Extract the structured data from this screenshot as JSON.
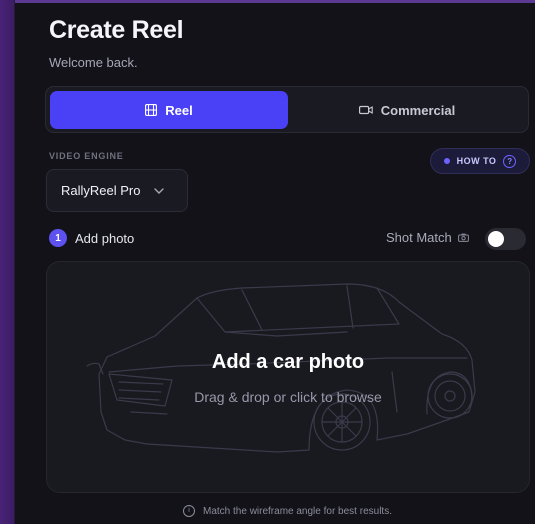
{
  "header": {
    "title": "Create Reel",
    "subtitle": "Welcome back."
  },
  "tabs": [
    {
      "label": "Reel",
      "icon": "film-icon",
      "active": true
    },
    {
      "label": "Commercial",
      "icon": "video-camera-icon",
      "active": false
    }
  ],
  "engine": {
    "label": "VIDEO ENGINE",
    "selected": "RallyReel Pro"
  },
  "how_to": {
    "label": "HOW TO"
  },
  "step": {
    "number": "1",
    "label": "Add photo"
  },
  "shot_match": {
    "label": "Shot Match",
    "enabled": false
  },
  "dropzone": {
    "title": "Add a car photo",
    "subtitle": "Drag & drop or click to browse"
  },
  "hint": {
    "text": "Match the wireframe angle for best results."
  },
  "colors": {
    "accent": "#4a40f5",
    "background": "#121218",
    "sidebar": "#4a2378"
  }
}
